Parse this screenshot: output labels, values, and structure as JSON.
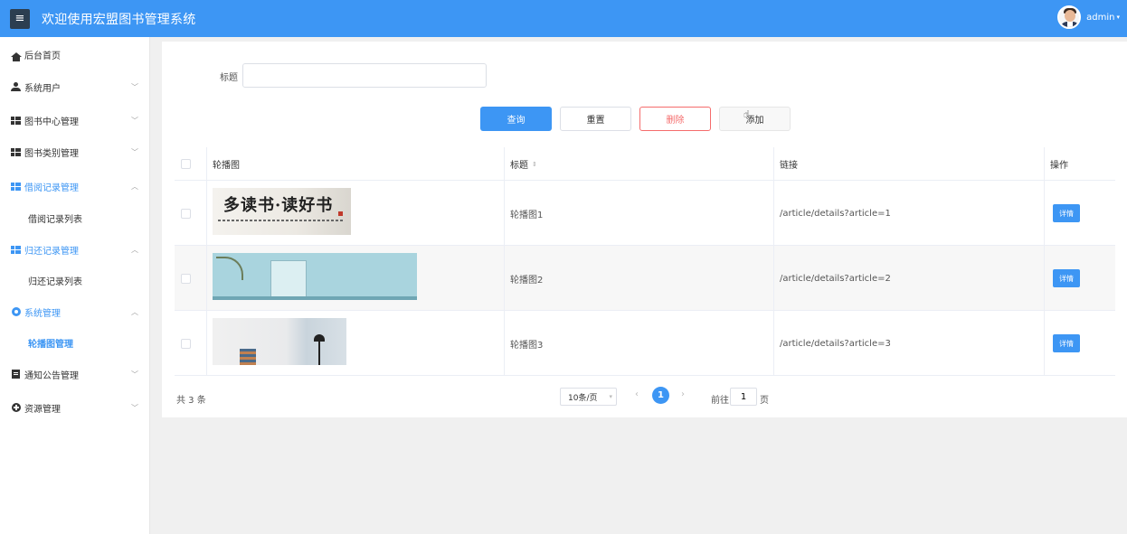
{
  "header": {
    "menu_icon": "≡",
    "title": "欢迎使用宏盟图书管理系统",
    "user_name": "admin",
    "caret": "▾",
    "colors": {
      "bar": "#3d96f4",
      "menu_button": "#2c3e50"
    }
  },
  "sidebar": {
    "items": [
      {
        "label": "后台首页",
        "icon": "home-icon"
      },
      {
        "label": "系统用户",
        "icon": "user-icon",
        "chevron": "﹀"
      },
      {
        "label": "图书中心管理",
        "icon": "grid-icon",
        "chevron": "﹀"
      },
      {
        "label": "图书类别管理",
        "icon": "grid-icon",
        "chevron": "﹀"
      },
      {
        "label": "借阅记录管理",
        "icon": "grid-icon",
        "chevron": "︿"
      },
      {
        "label": "借阅记录列表",
        "sub": true
      },
      {
        "label": "归还记录管理",
        "icon": "grid-icon",
        "chevron": "︿"
      },
      {
        "label": "归还记录列表",
        "sub": true
      },
      {
        "label": "系统管理",
        "icon": "gear-icon",
        "chevron": "︿"
      },
      {
        "label": "轮播图管理",
        "sub": true,
        "current": true
      },
      {
        "label": "通知公告管理",
        "icon": "doc-icon",
        "chevron": "﹀"
      },
      {
        "label": "资源管理",
        "icon": "plus-circle-icon",
        "chevron": "﹀"
      }
    ]
  },
  "search": {
    "label": "标题",
    "value": "",
    "placeholder": ""
  },
  "actions": {
    "query": "查询",
    "reset": "重置",
    "delete": "删除",
    "add": "添加"
  },
  "table": {
    "headers": {
      "image": "轮播图",
      "title": "标题",
      "sort": "⇕",
      "link": "链接",
      "op": "操作"
    },
    "rows": [
      {
        "title": "轮播图1",
        "link": "/article/details?article=1",
        "action": "详情",
        "banner_text": "多读书·读好书"
      },
      {
        "title": "轮播图2",
        "link": "/article/details?article=2",
        "action": "详情"
      },
      {
        "title": "轮播图3",
        "link": "/article/details?article=3",
        "action": "详情"
      }
    ]
  },
  "pagination": {
    "total": "共 3 条",
    "page_size": "10条/页",
    "prev": "‹",
    "current_page": "1",
    "next": "›",
    "goto_label": "前往",
    "goto_value": "1",
    "goto_unit": "页"
  }
}
